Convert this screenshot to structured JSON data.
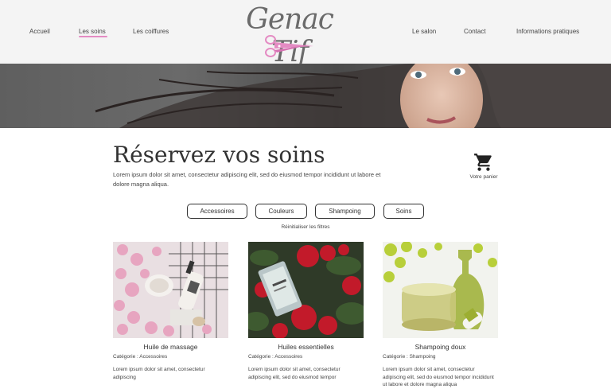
{
  "nav": {
    "left": [
      "Accueil",
      "Les soins",
      "Les coiffures"
    ],
    "right": [
      "Le salon",
      "Contact",
      "Informations pratiques"
    ]
  },
  "logo": {
    "text": "Genac Tif"
  },
  "page": {
    "title": "Réservez vos soins",
    "intro": "Lorem ipsum dolor sit amet, consectetur adipiscing elit, sed do eiusmod tempor incididunt ut labore et dolore magna aliqua."
  },
  "cart": {
    "label": "Votre panier",
    "icon": "shopping-cart-icon"
  },
  "filters": {
    "buttons": [
      "Accessoires",
      "Couleurs",
      "Shampoing",
      "Soins"
    ],
    "reset": "Réinitialiser les filtres"
  },
  "products": [
    {
      "name": "Huile de massage",
      "category": "Catégorie : Accessoires",
      "description": "Lorem ipsum dolor sit amet, consectetur adipiscing"
    },
    {
      "name": "Huiles essentielles",
      "category": "Catégorie : Accessoires",
      "description": "Lorem ipsum dolor sit amet, consectetur adipiscing elit, sed do eiusmod tempor"
    },
    {
      "name": "Shampoing doux",
      "category": "Catégorie : Shampoing",
      "description": "Lorem ipsum dolor sit amet, consectetur adipiscing elit, sed do eiusmod tempor incididunt ut labore et dolore magna aliqua"
    }
  ],
  "colors": {
    "accent": "#e48bc3",
    "header_bg": "#f4f4f4",
    "text": "#333333"
  }
}
